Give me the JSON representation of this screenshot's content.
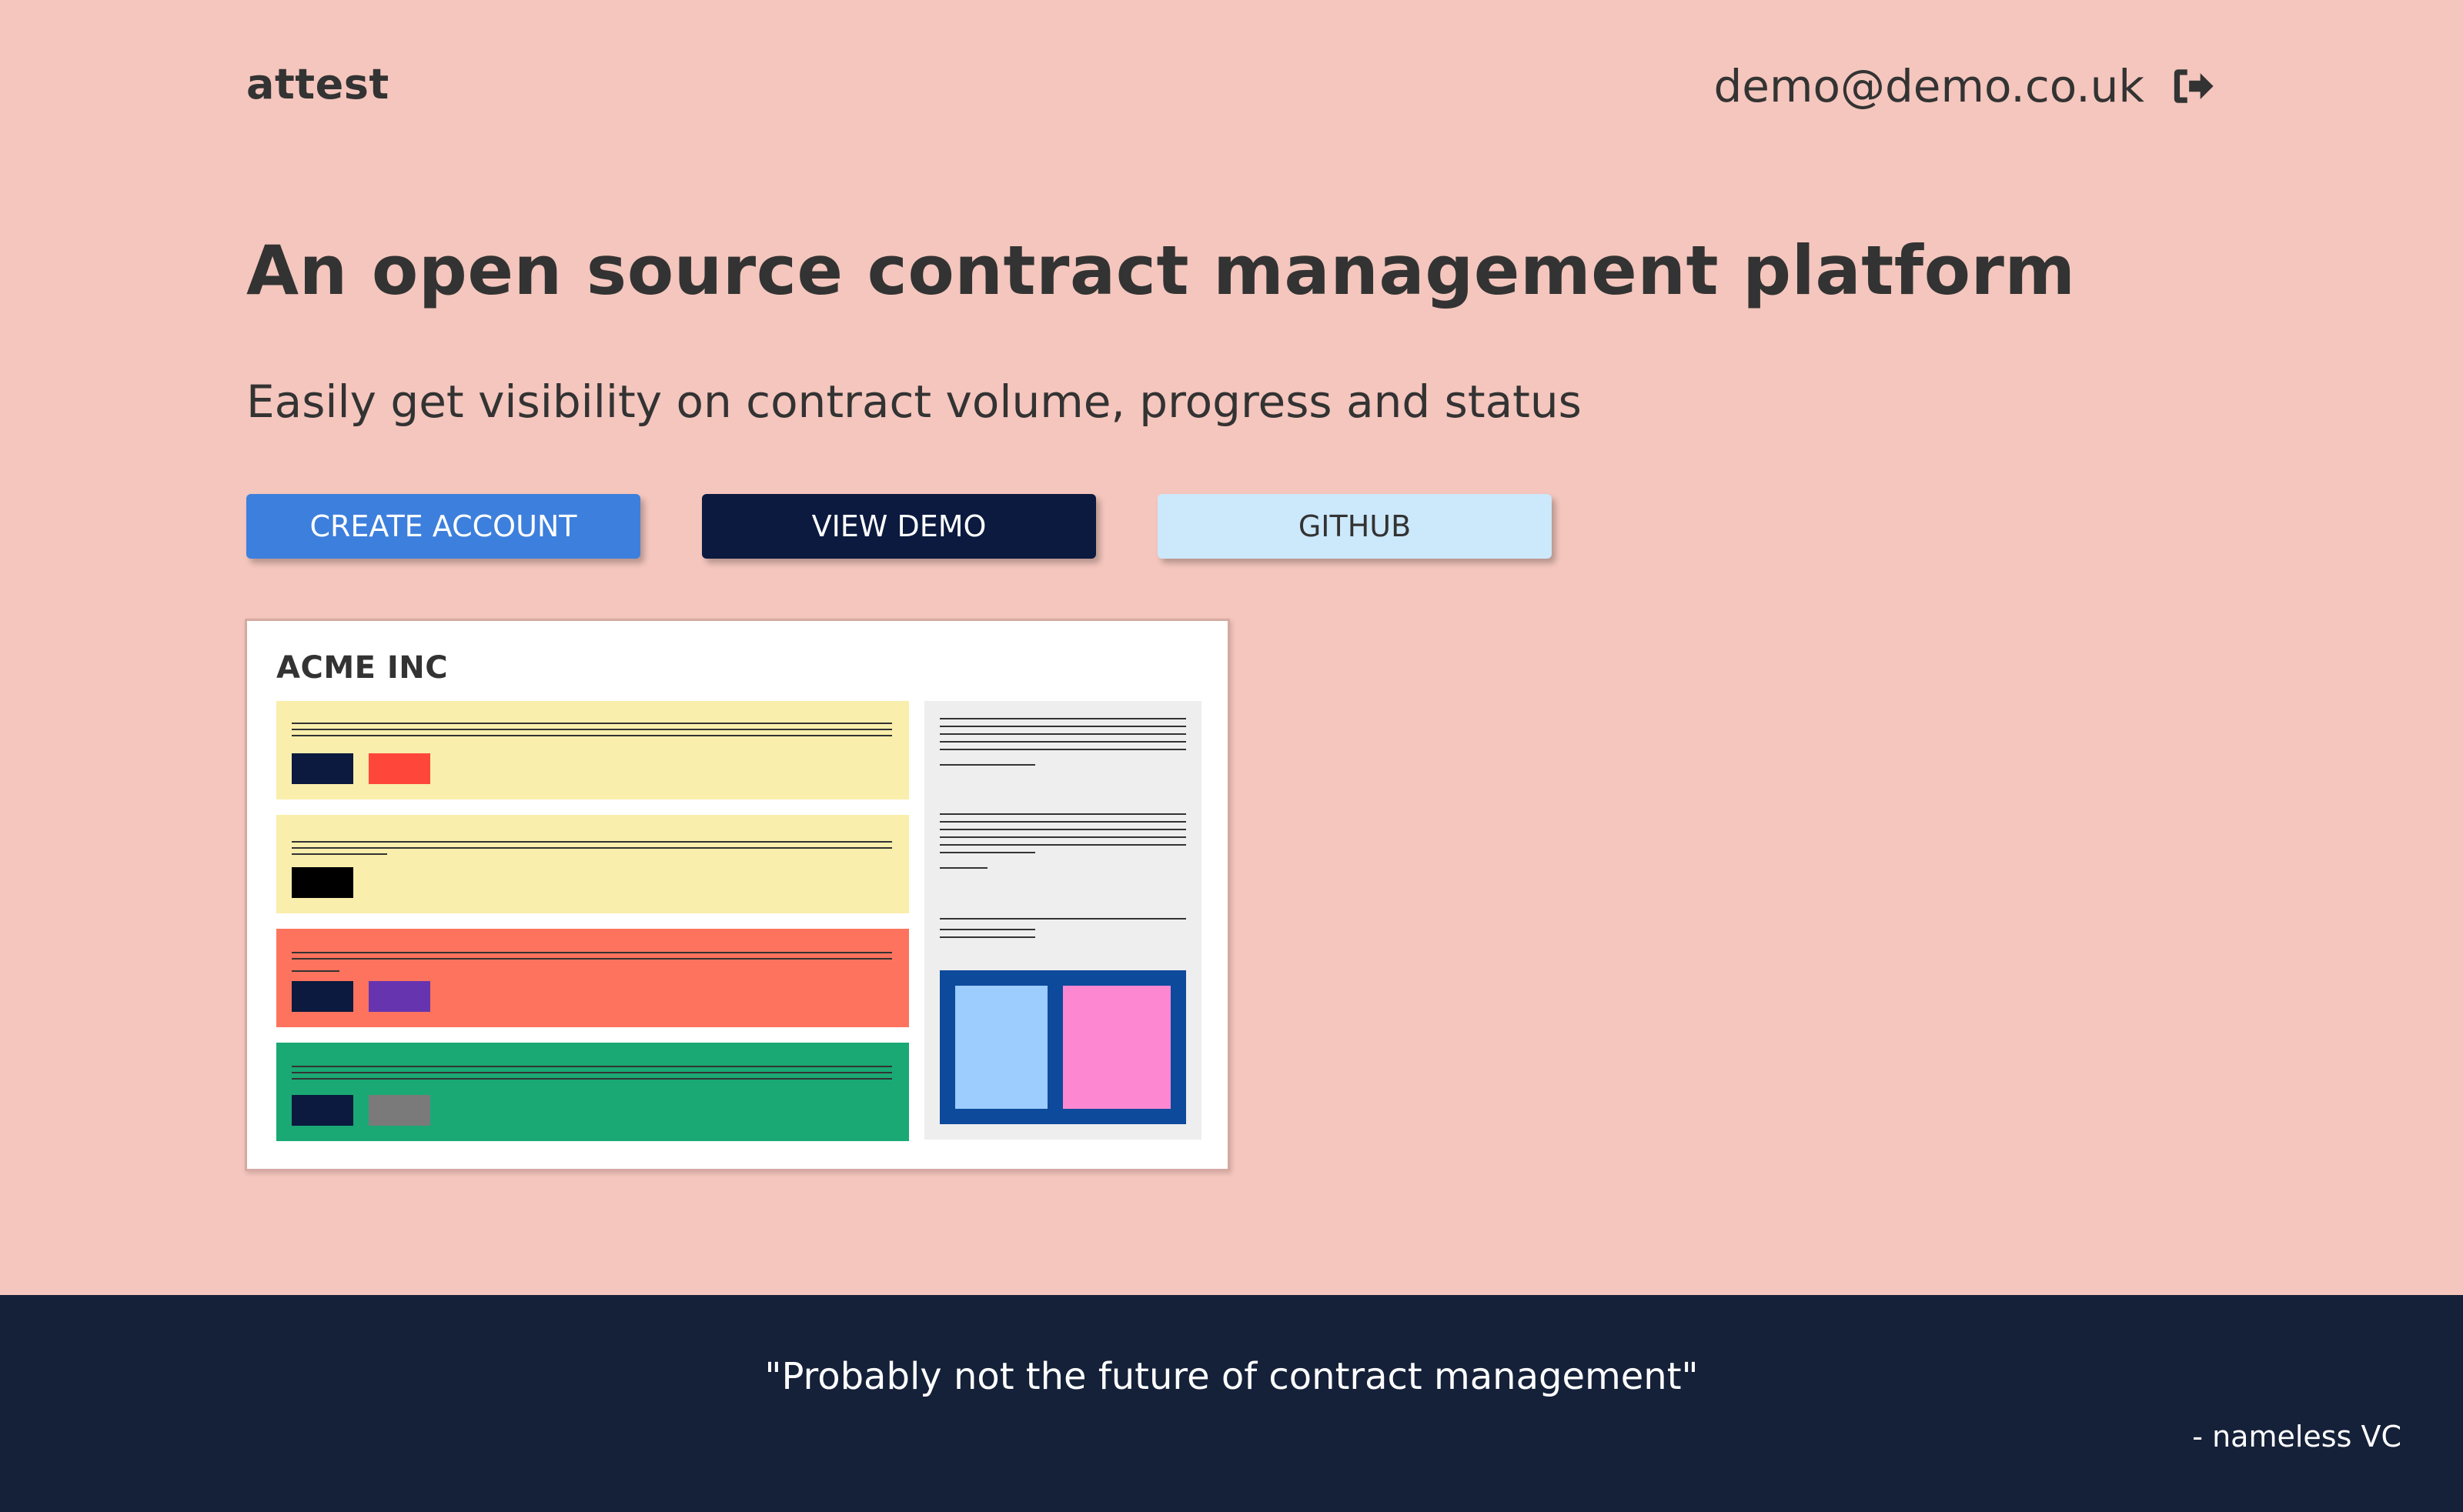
{
  "brand": "attest",
  "account": {
    "email": "demo@demo.co.uk",
    "logout_icon": "logout-icon"
  },
  "hero": {
    "headline": "An open source contract management platform",
    "subheadline": "Easily get visibility on contract volume, progress and status"
  },
  "buttons": {
    "create_account": "CREATE ACCOUNT",
    "view_demo": "VIEW DEMO",
    "github": "GITHUB"
  },
  "preview": {
    "company": "ACME INC",
    "card_colors": [
      "#f9eeac",
      "#f9eeac",
      "#fe735d",
      "#1aa974"
    ],
    "tag_colors": [
      [
        "#0b1a3e",
        "#fe473a"
      ],
      [
        "#000000"
      ],
      [
        "#0b1a3e",
        "#6734b0"
      ],
      [
        "#0b1a3e",
        "#7a7a7a"
      ]
    ],
    "image_colors": {
      "frame": "#0d4a9c",
      "left": "#9dccfe",
      "right": "#fe87d1"
    }
  },
  "footer": {
    "quote": "\"Probably not the future of contract management\"",
    "attribution": "- nameless VC"
  }
}
